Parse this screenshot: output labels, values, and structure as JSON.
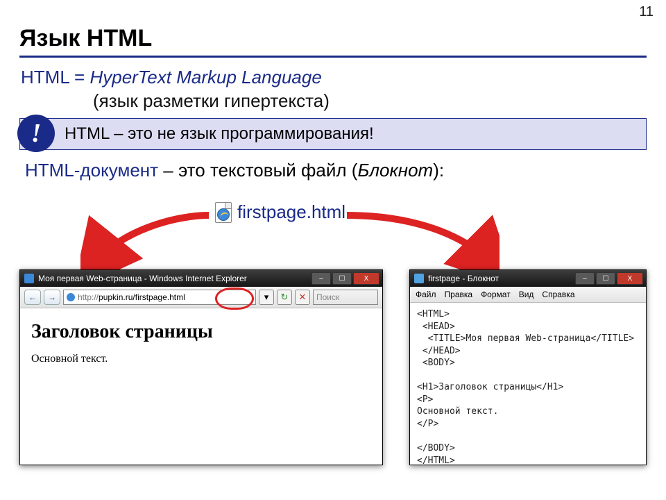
{
  "page_number": "11",
  "slide_title": "Язык HTML",
  "definition": {
    "lhs": "HTML = ",
    "rhs_italic": "HyperText Markup Language",
    "sub": "(язык разметки гипертекста)"
  },
  "alert": {
    "bang": "!",
    "text": "HTML – это не язык программирования!"
  },
  "doc_line": {
    "key": "HTML-документ",
    "mid": " – это текстовый файл (",
    "italic": "Блокнот",
    "end": "):"
  },
  "file_chip": "firstpage.html",
  "ie": {
    "title": "Моя первая Web-страница - Windows Internet Explorer",
    "nav_back": "←",
    "nav_fwd": "→",
    "proto_label": "http://",
    "url": "pupkin.ru/firstpage.html",
    "refresh": "↻",
    "stop": "✕",
    "search_ph": "Поиск",
    "heading": "Заголовок страницы",
    "body": "Основной текст."
  },
  "np": {
    "title": "firstpage - Блокнот",
    "menu": [
      "Файл",
      "Правка",
      "Формат",
      "Вид",
      "Справка"
    ],
    "code": "<HTML>\n <HEAD>\n  <TITLE>Моя первая Web-страница</TITLE>\n </HEAD>\n <BODY>\n\n<H1>Заголовок страницы</H1>\n<P>\nОсновной текст.\n</P>\n\n</BODY>\n</HTML>"
  },
  "winctl": {
    "min": "–",
    "max": "☐",
    "close": "X"
  }
}
